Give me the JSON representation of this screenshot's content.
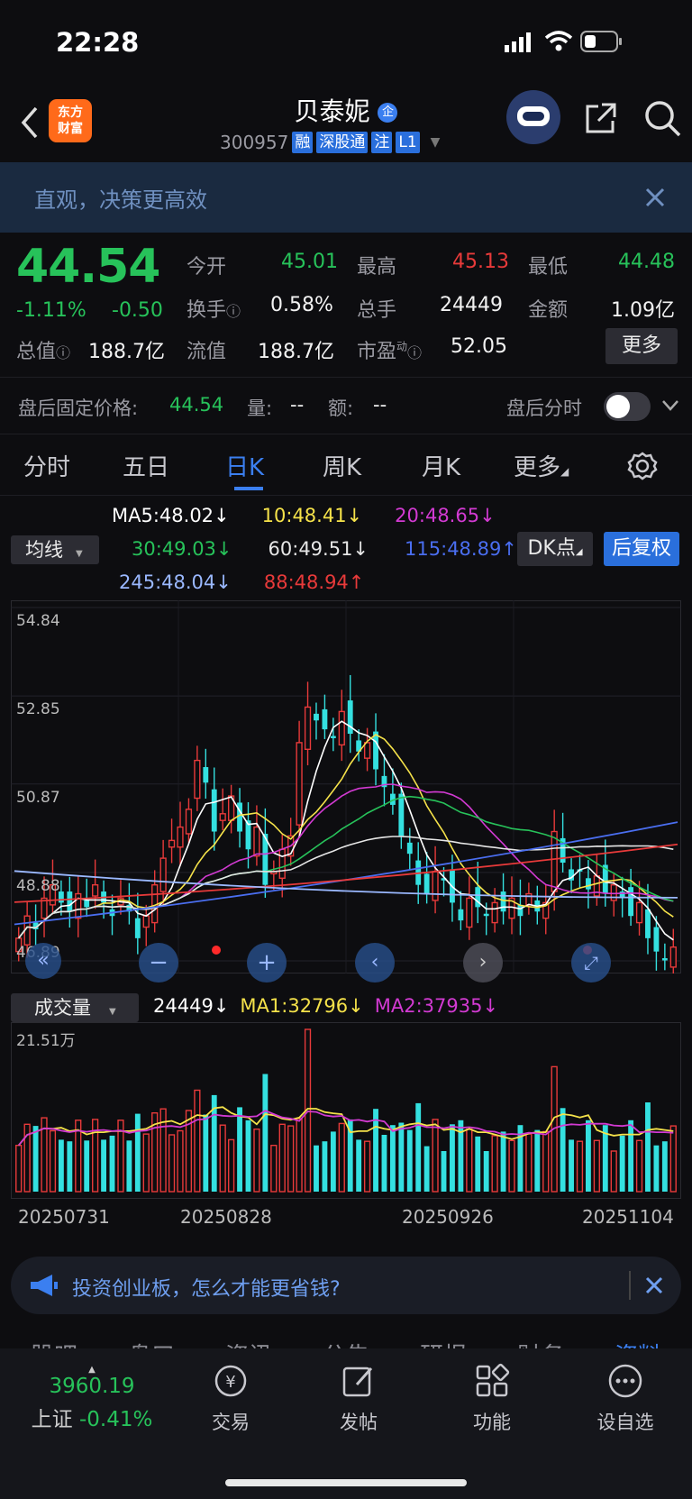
{
  "status": {
    "time": "22:28"
  },
  "nav": {
    "brand": "东方\n财富",
    "title": "贝泰妮",
    "title_badge": "企",
    "code": "300957",
    "tags": [
      "融",
      "深股通",
      "注",
      "L1"
    ]
  },
  "banner": {
    "text": "直观，决策更高效"
  },
  "quote": {
    "price": "44.54",
    "change_pct": "-1.11%",
    "change": "-0.50",
    "open_label": "今开",
    "open": "45.01",
    "high_label": "最高",
    "high": "45.13",
    "low_label": "最低",
    "low": "44.48",
    "turnover_label": "换手",
    "turnover": "0.58%",
    "volume_label": "总手",
    "volume": "24449",
    "amount_label": "金额",
    "amount": "1.09亿",
    "mcap_label": "总值",
    "mcap": "188.7亿",
    "float_label": "流值",
    "float": "188.7亿",
    "pe_label": "市盈",
    "pe_sup": "动",
    "pe": "52.05",
    "more": "更多"
  },
  "afterhours": {
    "label": "盘后固定价格:",
    "price": "44.54",
    "vol_label": "量:",
    "vol": "--",
    "amt_label": "额:",
    "amt": "--",
    "switch_label": "盘后分时"
  },
  "tabs": [
    "分时",
    "五日",
    "日K",
    "周K",
    "月K",
    "更多"
  ],
  "indicator": {
    "selector": "均线",
    "ma": [
      {
        "label": "MA5:48.02↓",
        "color": "#ffffff"
      },
      {
        "label": "10:48.41↓",
        "color": "#f5e24a"
      },
      {
        "label": "20:48.65↓",
        "color": "#d23ad2"
      },
      {
        "label": "30:49.03↓",
        "color": "#27c25a"
      },
      {
        "label": "60:49.51↓",
        "color": "#e6e6e6"
      },
      {
        "label": "115:48.89↑",
        "color": "#4a6ef0"
      },
      {
        "label": "245:48.04↓",
        "color": "#9ab8ff"
      },
      {
        "label": "88:48.94↑",
        "color": "#e83a3a"
      }
    ],
    "dk": "DK点",
    "adjust": "后复权"
  },
  "chart_data": {
    "type": "candlestick",
    "y_ticks": [
      "54.84",
      "52.85",
      "50.87",
      "48.88",
      "46.89"
    ],
    "ylim": [
      46.89,
      54.84
    ],
    "dates": [
      "20250731",
      "20250828",
      "20250926",
      "20251104"
    ],
    "closes": [
      47.4,
      47.9,
      47.6,
      48.3,
      48.6,
      48.2,
      48.0,
      48.4,
      48.1,
      48.6,
      48.2,
      47.9,
      48.3,
      48.0,
      47.4,
      47.9,
      48.6,
      49.2,
      49.6,
      49.9,
      50.3,
      51.4,
      50.9,
      49.8,
      50.2,
      50.6,
      49.8,
      49.4,
      49.9,
      48.6,
      48.9,
      49.4,
      49.7,
      51.8,
      52.6,
      52.3,
      52.1,
      51.9,
      52.5,
      52.0,
      51.6,
      51.8,
      51.2,
      50.8,
      50.4,
      49.7,
      49.3,
      48.6,
      48.4,
      48.9,
      48.7,
      48.2,
      47.8,
      48.3,
      48.1,
      47.9,
      48.2,
      48.0,
      48.3,
      47.9,
      48.4,
      48.0,
      48.2,
      49.8,
      49.1,
      48.7,
      48.9,
      48.5,
      48.8,
      48.4,
      48.6,
      48.3,
      47.9,
      48.2,
      47.4,
      47.1,
      46.9,
      47.2
    ]
  },
  "volume": {
    "selector": "成交量",
    "current": "24449↓",
    "ma1": "MA1:32796↓",
    "ma2": "MA2:37935↓",
    "ymax_label": "21.51万"
  },
  "promo": {
    "text": "投资创业板，怎么才能更省钱?"
  },
  "bottom": {
    "index_value": "3960.19",
    "index_name": "上证",
    "index_change": "-0.41%",
    "items": [
      "交易",
      "发帖",
      "功能",
      "设自选"
    ],
    "peek_tabs": [
      "股吧",
      "盘口",
      "资讯",
      "公告",
      "研报",
      "财务",
      "资料"
    ]
  }
}
